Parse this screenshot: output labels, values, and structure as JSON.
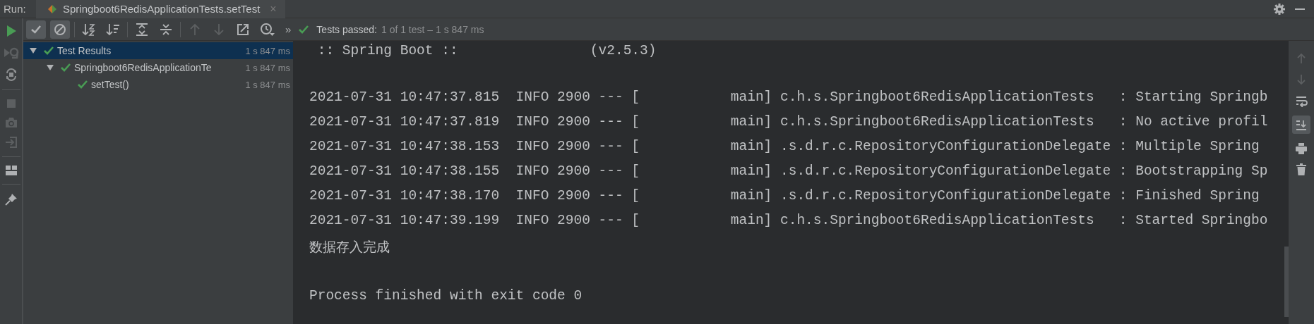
{
  "run_label": "Run:",
  "run_tab": {
    "title": "Springboot6RedisApplicationTests.setTest",
    "selected": true,
    "close": "×"
  },
  "test_toolbar": {
    "filters": [
      {
        "kind": "passed",
        "selected": true
      },
      {
        "kind": "ignored",
        "selected": true
      }
    ],
    "overflow": "»",
    "status_label": "Tests passed:",
    "status_detail": "1 of 1 test – 1 s 847 ms"
  },
  "tree": [
    {
      "label": "Test Results",
      "time": "1 s 847 ms",
      "selected": true,
      "expanded": true,
      "children": [
        {
          "label": "Springboot6RedisApplicationTe",
          "time": "1 s 847 ms",
          "selected": false,
          "expanded": true,
          "children": [
            {
              "label": "setTest()",
              "time": "1 s 847 ms",
              "selected": false
            }
          ]
        }
      ]
    }
  ],
  "console": {
    "banner": ":: Spring Boot ::                (v2.5.3)",
    "lines": [
      "2021-07-31 10:47:37.815  INFO 2900 --- [           main] c.h.s.Springboot6RedisApplicationTests   : Starting Springb",
      "2021-07-31 10:47:37.819  INFO 2900 --- [           main] c.h.s.Springboot6RedisApplicationTests   : No active profil",
      "2021-07-31 10:47:38.153  INFO 2900 --- [           main] .s.d.r.c.RepositoryConfigurationDelegate : Multiple Spring",
      "2021-07-31 10:47:38.155  INFO 2900 --- [           main] .s.d.r.c.RepositoryConfigurationDelegate : Bootstrapping Sp",
      "2021-07-31 10:47:38.170  INFO 2900 --- [           main] .s.d.r.c.RepositoryConfigurationDelegate : Finished Spring",
      "2021-07-31 10:47:39.199  INFO 2900 --- [           main] c.h.s.Springboot6RedisApplicationTests   : Started Springbo"
    ],
    "output": "数据存入完成",
    "exit_message": "Process finished with exit code 0"
  }
}
